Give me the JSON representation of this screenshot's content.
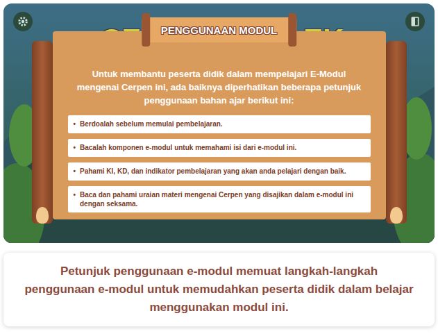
{
  "title": {
    "left": "CE",
    "right": "EK"
  },
  "banner": "PENGGUNAAN MODUL",
  "intro": "Untuk membantu peserta didik dalam mempelajari E-Modul mengenai Cerpen ini, ada baiknya diperhatikan beberapa petunjuk penggunaan bahan ajar berikut ini:",
  "bullet": "•",
  "steps": [
    "Berdoalah sebelum memulai pembelajaran.",
    "Bacalah komponen e-modul untuk memahami isi dari e-modul ini.",
    "Pahami KI, KD, dan indikator pembelajaran yang akan anda pelajari dengan baik.",
    "Baca dan pahami uraian materi mengenai Cerpen yang disajikan dalam e-modul ini dengan seksama."
  ],
  "caption": "Petunjuk penggunaan e-modul memuat langkah-langkah penggunaan e-modul untuk memudahkan peserta didik dalam belajar menggunakan modul ini."
}
